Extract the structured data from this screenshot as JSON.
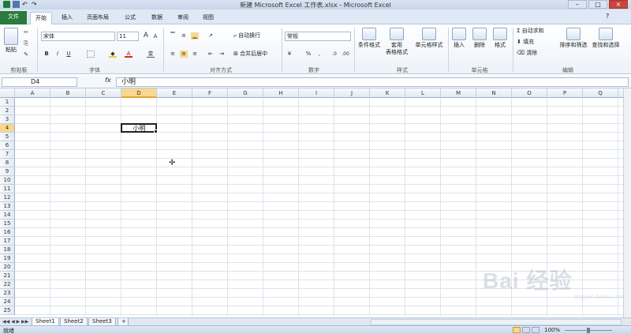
{
  "window": {
    "title": "新建 Microsoft Excel 工作表.xlsx - Microsoft Excel"
  },
  "tabs": {
    "file": "文件",
    "items": [
      "开始",
      "插入",
      "页面布局",
      "公式",
      "数据",
      "审阅",
      "视图"
    ]
  },
  "ribbon": {
    "groups": {
      "clipboard": "剪贴板",
      "font": "字体",
      "alignment": "对齐方式",
      "number": "数字",
      "styles": "样式",
      "cells": "单元格",
      "editing": "编辑"
    },
    "clipboard": {
      "paste": "粘贴"
    },
    "font": {
      "name": "宋体",
      "size": "11",
      "bold": "B",
      "italic": "I",
      "underline": "U",
      "grow": "A",
      "shrink": "A",
      "wen": "变"
    },
    "alignment": {
      "wrap": "自动换行",
      "merge": "合并后居中"
    },
    "number": {
      "format": "常规",
      "percent": "%",
      "comma": ",",
      "inc": ".0",
      "dec": ".00"
    },
    "styles": {
      "cond": "条件格式",
      "table1": "套用",
      "table2": "表格格式",
      "cell": "单元格样式"
    },
    "cells": {
      "insert": "插入",
      "delete": "删除",
      "format": "格式"
    },
    "editing": {
      "autosum": "自动求和",
      "fill": "填充",
      "clear": "清除",
      "sort": "排序和筛选",
      "find": "查找和选择"
    }
  },
  "formula": {
    "namebox": "D4",
    "fx": "fx",
    "value": "小明"
  },
  "grid": {
    "columns": [
      "A",
      "B",
      "C",
      "D",
      "E",
      "F",
      "G",
      "H",
      "I",
      "J",
      "K",
      "L",
      "M",
      "N",
      "O",
      "P",
      "Q"
    ],
    "rows": [
      "1",
      "2",
      "3",
      "4",
      "5",
      "6",
      "7",
      "8",
      "9",
      "10",
      "11",
      "12",
      "13",
      "14",
      "15",
      "16",
      "17",
      "18",
      "19",
      "20",
      "21",
      "22",
      "23",
      "24",
      "25"
    ],
    "selected_col": "D",
    "selected_row": "4",
    "cell_value": "小明"
  },
  "sheets": [
    "Sheet1",
    "Sheet2",
    "Sheet3"
  ],
  "status": {
    "ready": "就绪",
    "zoom": "100%"
  },
  "watermark": {
    "text": "Bai 经验",
    "url": "jingyan.baidu.com"
  }
}
